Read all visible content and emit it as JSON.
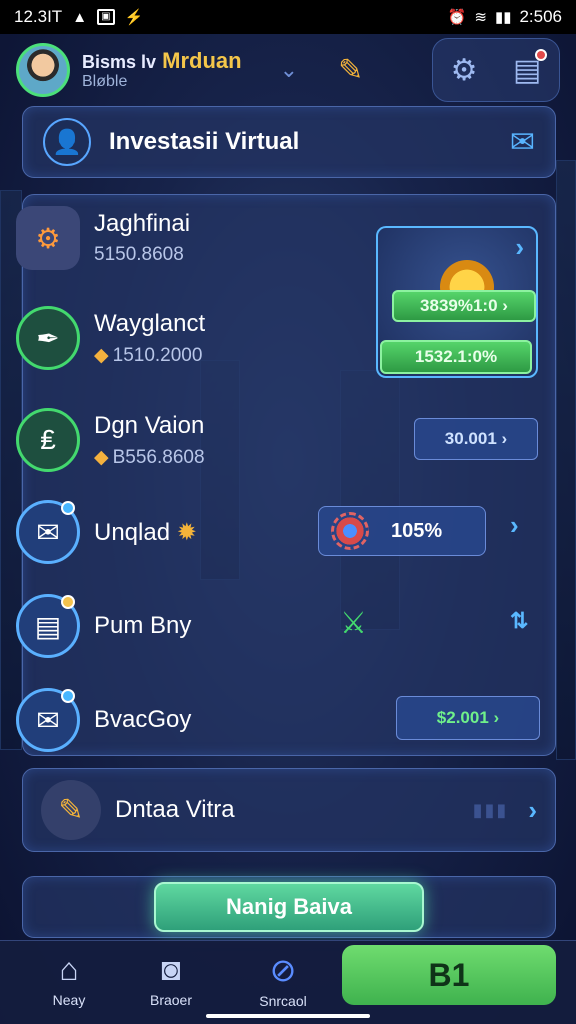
{
  "status_bar": {
    "time_left": "12.3IT",
    "time_right": "2:506"
  },
  "header": {
    "name_prefix": "Bisms lv",
    "name": "Mrduan",
    "subtitle": "Bløble"
  },
  "title_card": {
    "title": "Investasii Virtual"
  },
  "list": [
    {
      "title": "Jaghfinai",
      "sub": "5150.8608"
    },
    {
      "title": "Wayglanct",
      "sub": "1510.2000"
    },
    {
      "title": "Dgn Vaion",
      "sub": "B556.8608"
    },
    {
      "title": "Unqlad"
    },
    {
      "title": "Pum Bny"
    },
    {
      "title": "BvacGoy"
    }
  ],
  "promo": {
    "green_pill": "3839%1:0",
    "bottom_pill": "1532.1:0%"
  },
  "row_values": {
    "dgn_value": "30.001",
    "percent": "105%",
    "bvac_value": "$2.001"
  },
  "dntaa": {
    "label": "Dntaa Vitra"
  },
  "cta": {
    "label": "Nanig Baiva"
  },
  "bottom_nav": {
    "items": [
      {
        "label": "Neay",
        "icon": "home-icon"
      },
      {
        "label": "Braoer",
        "icon": "camera-icon"
      },
      {
        "label": "Snrcaol",
        "icon": "compass-icon"
      }
    ],
    "primary_label": "B1"
  },
  "colors": {
    "accent_green": "#43d96e",
    "accent_blue": "#5ab8ff",
    "accent_gold": "#f3b33a"
  }
}
